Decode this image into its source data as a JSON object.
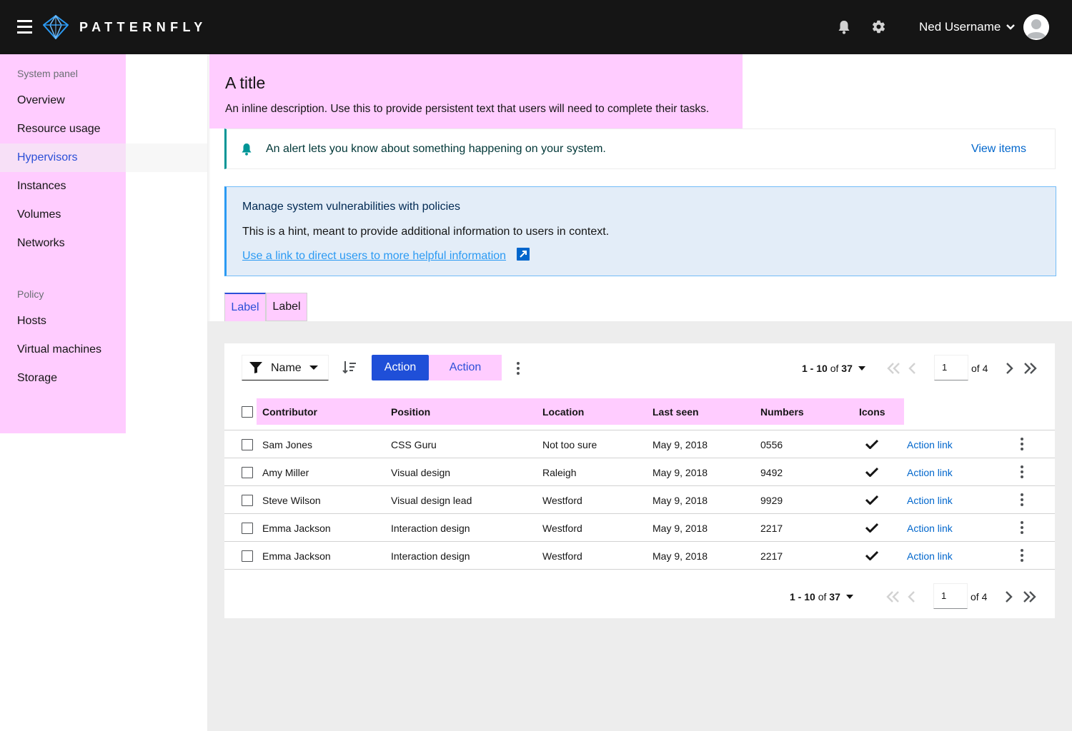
{
  "header": {
    "brand": "PATTERNFLY",
    "user_name": "Ned Username"
  },
  "sidebar": {
    "section1_title": "System panel",
    "section1_items": [
      "Overview",
      "Resource usage",
      "Hypervisors",
      "Instances",
      "Volumes",
      "Networks"
    ],
    "active_item": "Hypervisors",
    "section2_title": "Policy",
    "section2_items": [
      "Hosts",
      "Virtual machines",
      "Storage"
    ]
  },
  "page": {
    "title": "A title",
    "description": "An inline description. Use this to provide persistent text that users will need to complete their tasks."
  },
  "alert": {
    "text": "An alert lets you know about something happening on your system.",
    "action": "View items"
  },
  "hint": {
    "title": "Manage system vulnerabilities with policies",
    "body": "This is a hint, meant to provide additional information to users in context.",
    "link": "Use a link to direct users to more helpful information"
  },
  "tabs": [
    "Label",
    "Label"
  ],
  "toolbar": {
    "filter_label": "Name",
    "primary_action": "Action",
    "secondary_action": "Action"
  },
  "pagination": {
    "range": "1 - 10",
    "of_word": "of",
    "total": "37",
    "page": "1",
    "pages_label": "of 4"
  },
  "table": {
    "columns": [
      "Contributor",
      "Position",
      "Location",
      "Last seen",
      "Numbers",
      "Icons"
    ],
    "rows": [
      {
        "contributor": "Sam Jones",
        "position": "CSS Guru",
        "location": "Not too sure",
        "last_seen": "May 9, 2018",
        "numbers": "0556",
        "action": "Action link"
      },
      {
        "contributor": "Amy Miller",
        "position": "Visual design",
        "location": "Raleigh",
        "last_seen": "May 9, 2018",
        "numbers": "9492",
        "action": "Action link"
      },
      {
        "contributor": "Steve Wilson",
        "position": "Visual design lead",
        "location": "Westford",
        "last_seen": "May 9, 2018",
        "numbers": "9929",
        "action": "Action link"
      },
      {
        "contributor": "Emma Jackson",
        "position": "Interaction design",
        "location": "Westford",
        "last_seen": "May 9, 2018",
        "numbers": "2217",
        "action": "Action link"
      },
      {
        "contributor": "Emma Jackson",
        "position": "Interaction design",
        "location": "Westford",
        "last_seen": "May 9, 2018",
        "numbers": "2217",
        "action": "Action link"
      }
    ]
  },
  "colors": {
    "highlight": "#ffccff",
    "primary": "#1f4fd8",
    "link": "#0066cc",
    "alert_accent": "#009596",
    "hint_accent": "#2b9af3"
  },
  "icons": [
    "hamburger-icon",
    "patternfly-logo",
    "bell-icon",
    "gear-icon",
    "chevron-down-icon",
    "avatar",
    "external-link-icon",
    "filter-icon",
    "sort-icon",
    "kebab-icon",
    "first-page-icon",
    "previous-page-icon",
    "next-page-icon",
    "last-page-icon",
    "check-icon"
  ]
}
